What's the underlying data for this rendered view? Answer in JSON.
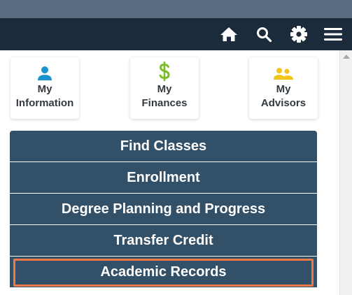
{
  "nav": {
    "icons": [
      "home-icon",
      "search-icon",
      "gear-icon",
      "menu-icon"
    ]
  },
  "tiles": [
    {
      "line1": "My",
      "line2": "Information",
      "icon": "person-icon",
      "color": "#1b93d1"
    },
    {
      "line1": "My",
      "line2": "Finances",
      "icon": "dollar-icon",
      "color": "#7cbd27"
    },
    {
      "line1": "My",
      "line2": "Advisors",
      "icon": "people-icon",
      "color": "#f2c51b"
    }
  ],
  "menu": {
    "items": [
      {
        "label": "Find Classes"
      },
      {
        "label": "Enrollment"
      },
      {
        "label": "Degree Planning and Progress"
      },
      {
        "label": "Transfer Credit"
      },
      {
        "label": "Academic Records"
      }
    ]
  },
  "colors": {
    "nav_bg": "#1c2b3b",
    "menu_bg": "#325068",
    "highlight": "#ee7b47"
  }
}
